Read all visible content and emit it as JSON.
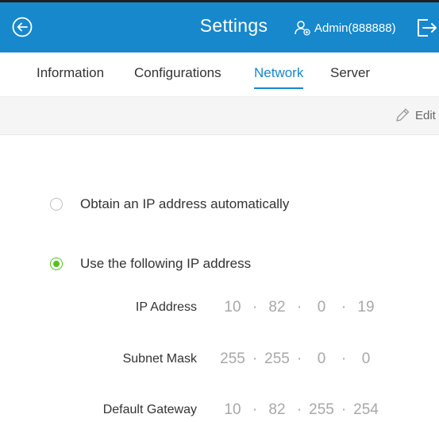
{
  "header": {
    "title": "Settings",
    "user": "Admin(888888)",
    "background_color": "#1788cc"
  },
  "tabs": [
    {
      "label": "Information",
      "active": false
    },
    {
      "label": "Configurations",
      "active": false
    },
    {
      "label": "Network",
      "active": true
    },
    {
      "label": "Server",
      "active": false
    }
  ],
  "toolbar": {
    "edit_label": "Edit"
  },
  "ip_mode": {
    "auto_label": "Obtain an IP address automatically",
    "manual_label": "Use the following IP address",
    "selected": "manual"
  },
  "fields": {
    "ip_address": {
      "label": "IP Address",
      "octets": [
        "10",
        "82",
        "0",
        "19"
      ]
    },
    "subnet_mask": {
      "label": "Subnet Mask",
      "octets": [
        "255",
        "255",
        "0",
        "0"
      ]
    },
    "default_gateway": {
      "label": "Default Gateway",
      "octets": [
        "10",
        "82",
        "255",
        "254"
      ]
    }
  },
  "colors": {
    "accent": "#1788cc",
    "radio_selected": "#52c41a",
    "disabled_value": "#a8a8a8"
  }
}
